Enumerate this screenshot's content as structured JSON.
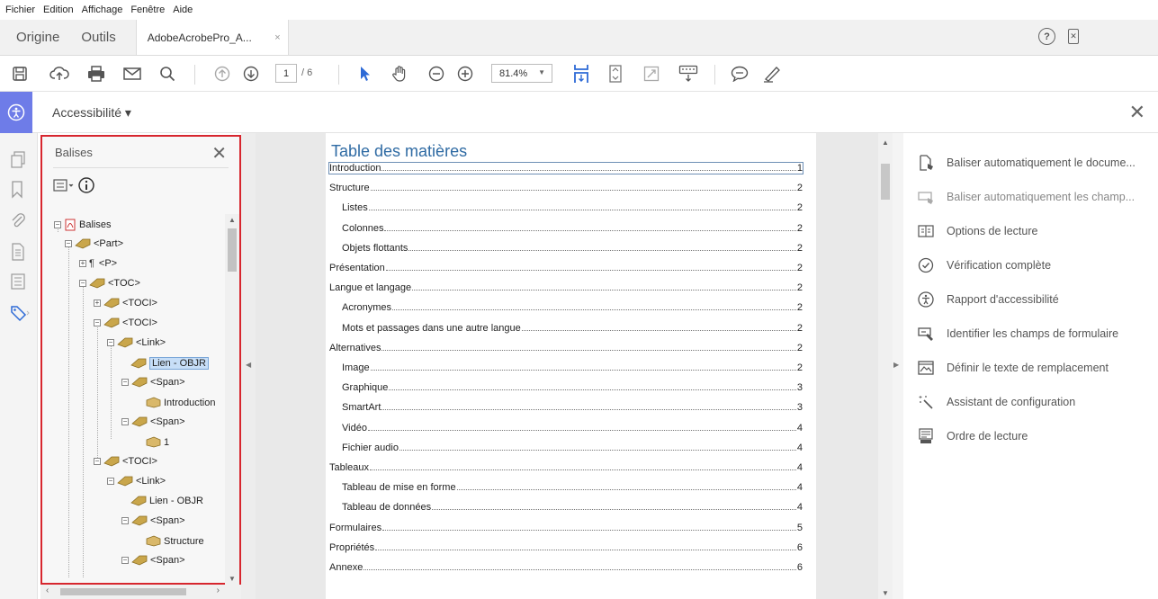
{
  "menu": [
    "Fichier",
    "Edition",
    "Affichage",
    "Fenêtre",
    "Aide"
  ],
  "tabs": {
    "home": "Origine",
    "tools": "Outils",
    "document": "AdobeAcrobePro_A...",
    "document_close": "×"
  },
  "toolbar": {
    "page_current": "1",
    "page_total": "/ 6",
    "zoom": "81.4%"
  },
  "tool_header": {
    "title": "Accessibilité ▾"
  },
  "tags_panel": {
    "title": "Balises",
    "tree": [
      {
        "label": "Balises",
        "icon": "pdf-icon"
      },
      {
        "label": "<Part>",
        "icon": "tag-icon"
      },
      {
        "label": "<P>",
        "icon": "paragraph-icon"
      },
      {
        "label": "<TOC>",
        "icon": "tag-icon"
      },
      {
        "label": "<TOCI>",
        "icon": "tag-icon"
      },
      {
        "label": "<TOCI>",
        "icon": "tag-icon"
      },
      {
        "label": "<Link>",
        "icon": "tag-icon"
      },
      {
        "label": "Lien - OBJR",
        "icon": "tag-icon",
        "selected": true
      },
      {
        "label": "<Span>",
        "icon": "tag-icon"
      },
      {
        "label": "Introduction",
        "icon": "content-icon"
      },
      {
        "label": "<Span>",
        "icon": "tag-icon"
      },
      {
        "label": "1",
        "icon": "content-icon"
      },
      {
        "label": "<TOCI>",
        "icon": "tag-icon"
      },
      {
        "label": "<Link>",
        "icon": "tag-icon"
      },
      {
        "label": "Lien - OBJR",
        "icon": "tag-icon"
      },
      {
        "label": "<Span>",
        "icon": "tag-icon"
      },
      {
        "label": "Structure",
        "icon": "content-icon"
      },
      {
        "label": "<Span>",
        "icon": "tag-icon"
      }
    ]
  },
  "document": {
    "toc_title": "Table des matières",
    "entries": [
      {
        "label": "Introduction",
        "page": "1"
      },
      {
        "label": "Structure",
        "page": "2"
      },
      {
        "label": "Listes",
        "page": "2"
      },
      {
        "label": "Colonnes",
        "page": "2"
      },
      {
        "label": "Objets flottants",
        "page": "2"
      },
      {
        "label": "Présentation",
        "page": "2"
      },
      {
        "label": "Langue et langage",
        "page": "2"
      },
      {
        "label": "Acronymes",
        "page": "2"
      },
      {
        "label": "Mots et passages dans une autre langue",
        "page": "2"
      },
      {
        "label": "Alternatives",
        "page": "2"
      },
      {
        "label": "Image",
        "page": "2"
      },
      {
        "label": "Graphique",
        "page": "3"
      },
      {
        "label": "SmartArt",
        "page": "3"
      },
      {
        "label": "Vidéo",
        "page": "4"
      },
      {
        "label": "Fichier audio",
        "page": "4"
      },
      {
        "label": "Tableaux",
        "page": "4"
      },
      {
        "label": "Tableau de mise en forme",
        "page": "4"
      },
      {
        "label": "Tableau de données",
        "page": "4"
      },
      {
        "label": "Formulaires",
        "page": "5"
      },
      {
        "label": "Propriétés",
        "page": "6"
      },
      {
        "label": "Annexe",
        "page": "6"
      }
    ]
  },
  "right_panel": [
    {
      "label": "Baliser automatiquement le docume...",
      "icon": "autotag-doc-icon"
    },
    {
      "label": "Baliser automatiquement les champ...",
      "icon": "autotag-fields-icon",
      "disabled": true
    },
    {
      "label": "Options de lecture",
      "icon": "reading-options-icon"
    },
    {
      "label": "Vérification complète",
      "icon": "check-circle-icon"
    },
    {
      "label": "Rapport d'accessibilité",
      "icon": "accessibility-report-icon"
    },
    {
      "label": "Identifier les champs de formulaire",
      "icon": "form-fields-icon"
    },
    {
      "label": "Définir le texte de remplacement",
      "icon": "alt-text-icon"
    },
    {
      "label": "Assistant de configuration",
      "icon": "wizard-icon"
    },
    {
      "label": "Ordre de lecture",
      "icon": "reading-order-icon"
    }
  ],
  "colors": {
    "accent": "#6e7ce8",
    "panel_border": "#d7262e",
    "toc_title": "#2e6aa3",
    "tool_blue": "#2d6ad6"
  }
}
